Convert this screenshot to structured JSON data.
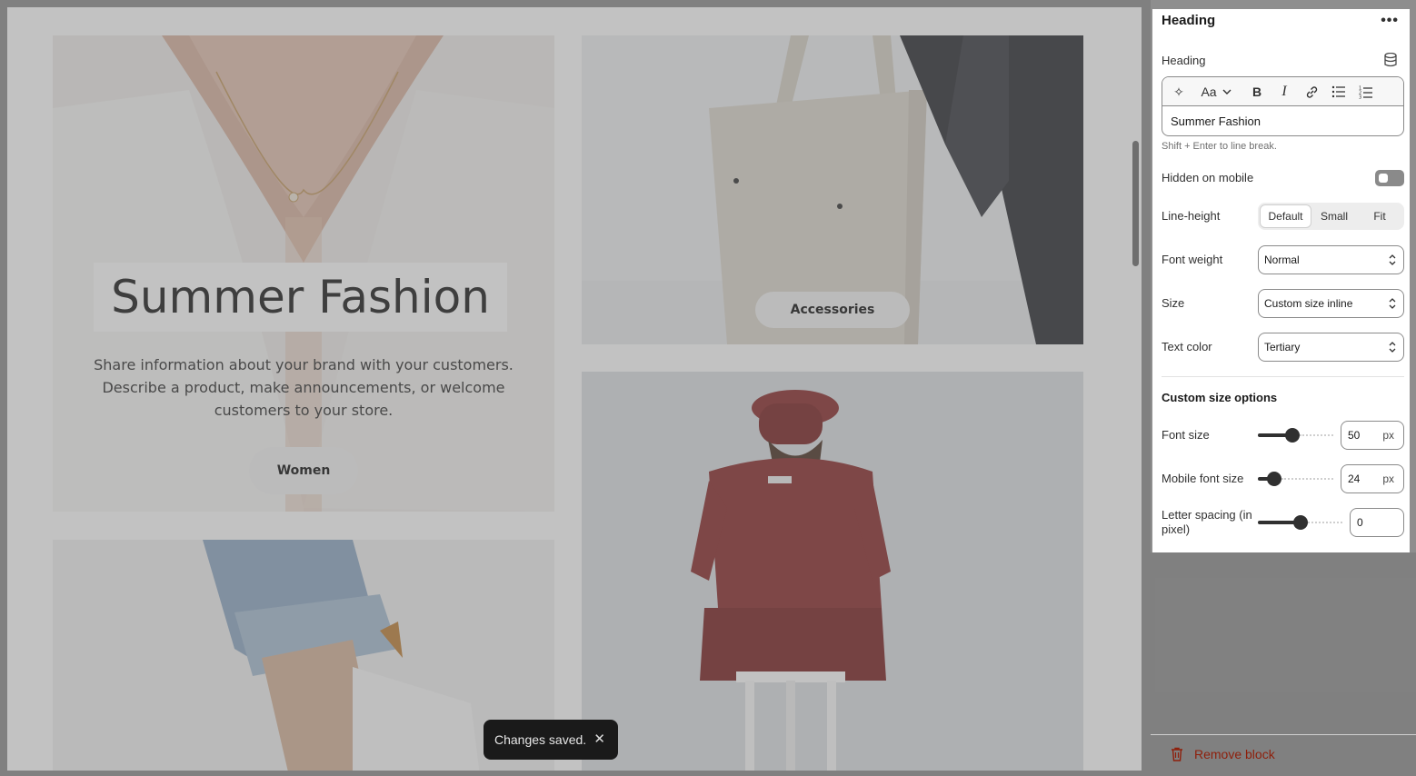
{
  "preview": {
    "heading": "Summer Fashion",
    "description": "Share information about your brand with your customers. Describe a product, make announcements, or welcome customers to your store.",
    "women_button": "Women",
    "accessories_button": "Accessories"
  },
  "toast": {
    "text": "Changes saved.",
    "close": "✕"
  },
  "panel": {
    "title": "Heading",
    "more": "•••",
    "heading_label": "Heading",
    "editor_value": "Summer Fashion",
    "editor_toolbar": {
      "ai": "✧",
      "font": "Aa",
      "bold": "B",
      "italic": "I"
    },
    "hint": "Shift + Enter to line break.",
    "hidden_on_mobile_label": "Hidden on mobile",
    "hidden_on_mobile": false,
    "line_height_label": "Line-height",
    "line_height_options": [
      "Default",
      "Small",
      "Fit"
    ],
    "line_height_selected": "Default",
    "font_weight_label": "Font weight",
    "font_weight": "Normal",
    "size_label": "Size",
    "size": "Custom size inline",
    "text_color_label": "Text color",
    "text_color": "Tertiary",
    "custom_size_title": "Custom size options",
    "font_size_label": "Font size",
    "font_size": "50",
    "font_size_unit": "px",
    "mobile_font_size_label": "Mobile font size",
    "mobile_font_size": "24",
    "mobile_font_size_unit": "px",
    "letter_spacing_label": "Letter spacing (in pixel)",
    "letter_spacing": "0",
    "remove_block": "Remove block"
  },
  "colors": {
    "danger": "#8e1f0b",
    "toast_bg": "#1a1a1a",
    "shirt": "#8a2b2b"
  }
}
